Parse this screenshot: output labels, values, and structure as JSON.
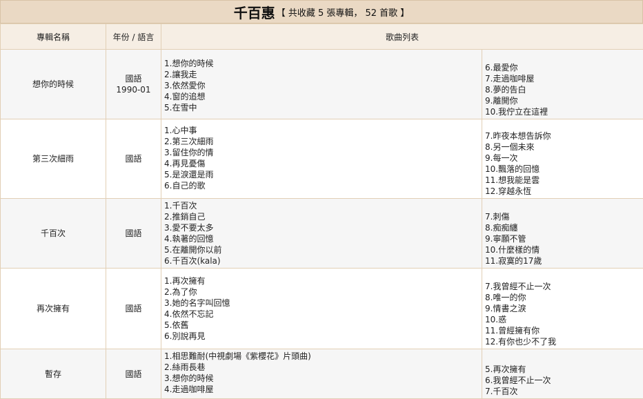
{
  "header": {
    "artist": "千百惠",
    "summary": "【 共收藏 5 張專輯， 52 首歌 】"
  },
  "columns": [
    "專輯名稱",
    "年份 / 語言",
    "歌曲列表"
  ],
  "albums": [
    {
      "name": "想你的時候",
      "language": "國語",
      "year": "1990-01",
      "songs_left": [
        "1.想你的時候",
        "2.讓我走",
        "3.依然愛你",
        "4.窗的追想",
        "5.在雪中"
      ],
      "songs_right": [
        "6.最愛你",
        "7.走過咖啡屋",
        "8.夢的告白",
        "9.離開你",
        "10.我佇立在這裡"
      ]
    },
    {
      "name": "第三次細雨",
      "language": "國語",
      "songs_left": [
        "1.心中事",
        "2.第三次細雨",
        "3.留住你的情",
        "4.再見憂傷",
        "5.是淚還是雨",
        "6.自己的歌"
      ],
      "songs_right": [
        "7.昨夜本想告訴你",
        "8.另一個未來",
        "9.每一次",
        "10.飄落的回憶",
        "11.想我能是雲",
        "12.穿越永恆"
      ]
    },
    {
      "name": "千百次",
      "language": "國語",
      "songs_left": [
        "1.千百次",
        "2.推銷自己",
        "3.愛不要太多",
        "4.執著的回憶",
        "5.在離開你以前",
        "6.千百次(kala)"
      ],
      "songs_right": [
        "7.刺傷",
        "8.痴痴纏",
        "9.寧願不管",
        "10.什麼樣的情",
        "11.寂寞的17歲"
      ]
    },
    {
      "name": "再次擁有",
      "language": "國語",
      "songs_left": [
        "1.再次擁有",
        "2.為了你",
        "3.她的名字叫回憶",
        "4.依然不忘記",
        "5.依舊",
        "6.別說再見"
      ],
      "songs_right": [
        "7.我曾經不止一次",
        "8.唯一的你",
        "9.情書之淚",
        "10.惑",
        "11.曾經擁有你",
        "12.有你也少不了我"
      ]
    },
    {
      "name": "暫存",
      "language": "國語",
      "songs_left": [
        "1.相思難耐(中視劇場《紫櫻花》片頭曲)",
        "2.絲雨長巷",
        "3.想你的時候",
        "4.走過咖啡屋"
      ],
      "songs_right": [
        "5.再次擁有",
        "6.我曾經不止一次",
        "7.千百次"
      ]
    }
  ],
  "colors": {
    "title_bg": "#ead9c4",
    "header_bg": "#f6eee4",
    "row_alt_bg": "#f6f6f6",
    "border": "#e2cfb5"
  }
}
